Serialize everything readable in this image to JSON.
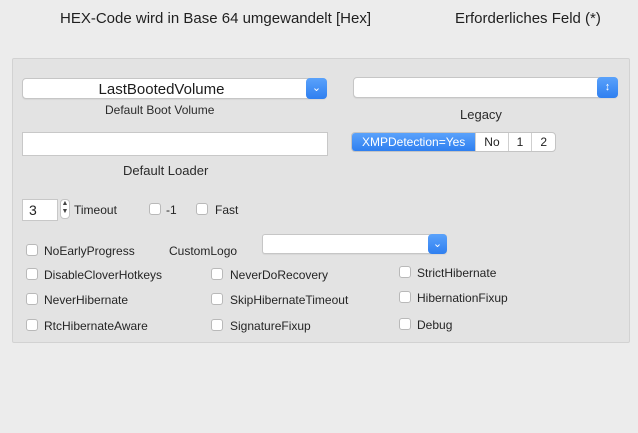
{
  "header": {
    "hex_note": "HEX-Code wird in Base 64 umgewandelt [Hex]",
    "required_note": "Erforderliches Feld (*)"
  },
  "boot": {
    "default_volume_value": "LastBootedVolume",
    "default_volume_label": "Default Boot Volume",
    "legacy_value": "",
    "legacy_label": "Legacy",
    "default_loader_value": "",
    "default_loader_label": "Default Loader",
    "xmp_options": [
      "XMPDetection=Yes",
      "No",
      "1",
      "2"
    ],
    "xmp_selected": "XMPDetection=Yes",
    "timeout_value": "3",
    "timeout_label": "Timeout",
    "minus_one_label": "-1",
    "fast_label": "Fast",
    "no_early_progress_label": "NoEarlyProgress",
    "custom_logo_label": "CustomLogo",
    "custom_logo_value": ""
  },
  "checkboxes": {
    "col1": [
      "DisableCloverHotkeys",
      "NeverHibernate",
      "RtcHibernateAware"
    ],
    "col2": [
      "NeverDoRecovery",
      "SkipHibernateTimeout",
      "SignatureFixup"
    ],
    "col3": [
      "StrictHibernate",
      "HibernationFixup",
      "Debug"
    ]
  },
  "colors": {
    "accent": "#3b86f5",
    "panel": "#e3e3e3",
    "window": "#ececec"
  },
  "icons": {
    "popup_arrow": "chevron-down-icon",
    "stepper": "up-down-stepper-icon"
  }
}
